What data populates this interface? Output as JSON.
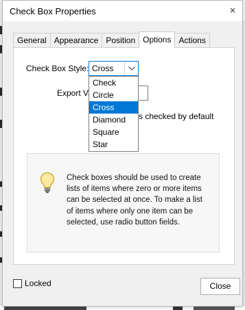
{
  "window": {
    "title": "Check Box Properties",
    "close_glyph": "×"
  },
  "tabs": [
    {
      "label": "General",
      "active": false
    },
    {
      "label": "Appearance",
      "active": false
    },
    {
      "label": "Position",
      "active": false
    },
    {
      "label": "Options",
      "active": true
    },
    {
      "label": "Actions",
      "active": false
    }
  ],
  "options": {
    "style_label": "Check Box Style:",
    "style_value": "Cross",
    "style_options": [
      "Check",
      "Circle",
      "Cross",
      "Diamond",
      "Square",
      "Star"
    ],
    "selected_option": "Cross",
    "export_label": "Export Value:",
    "default_checked_partial": "s checked by default",
    "info_text": "Check boxes should be used to create lists of items where zero or more items can be selected at once. To make a list of items where only one item can be selected, use radio button fields.",
    "info_icon": "lightbulb-icon"
  },
  "footer": {
    "locked_label": "Locked",
    "locked_checked": false,
    "close_label": "Close"
  },
  "colors": {
    "accent": "#0078d7",
    "dialog_bg": "#f0f0f0",
    "panel_bg": "#ffffff"
  }
}
